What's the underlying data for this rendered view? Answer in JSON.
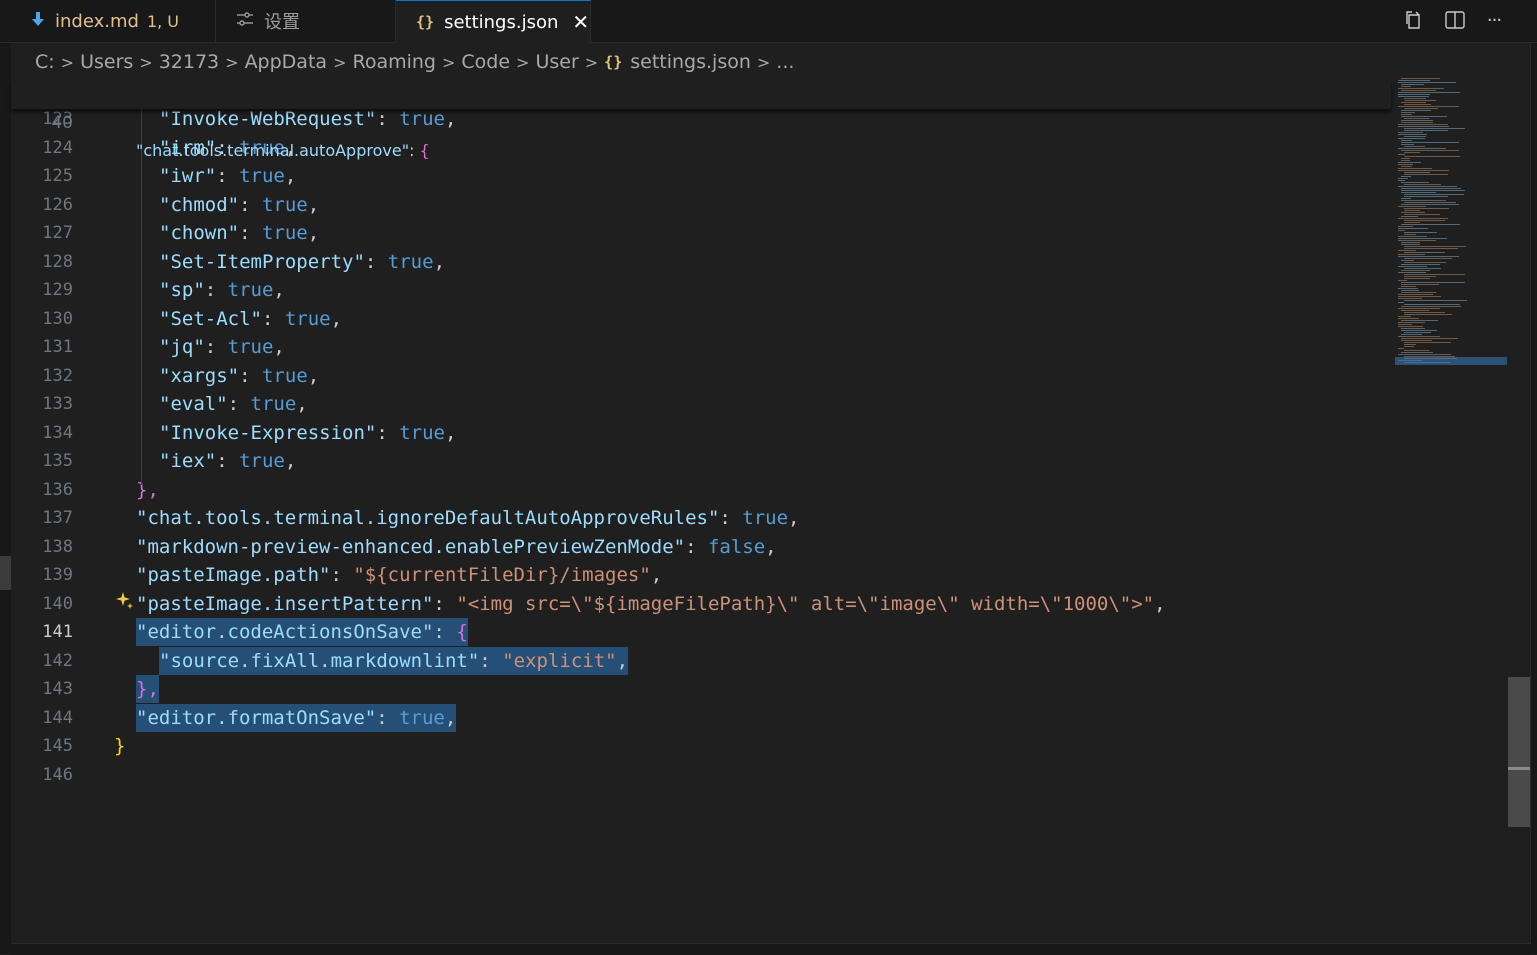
{
  "tabs": [
    {
      "icon": "markdown-icon",
      "name": "index.md",
      "badge": "1, U"
    },
    {
      "icon": "settings-sliders-icon",
      "name": "设置"
    },
    {
      "icon": "json-braces-icon",
      "name": "settings.json",
      "close": "✕"
    }
  ],
  "toolbar": {
    "open_changes": "open-changes-icon",
    "split_editor": "split-editor-icon",
    "more_actions": "···"
  },
  "breadcrumb": [
    "C:",
    "Users",
    "32173",
    "AppData",
    "Roaming",
    "Code",
    "User",
    "settings.json",
    "..."
  ],
  "sticky": {
    "num": "40",
    "key": "\"chat.tools.terminal.autoApprove\"",
    "colon": ": ",
    "brace": "{"
  },
  "lines": [
    {
      "num": "123",
      "key": "\"Invoke-WebRequest\"",
      "val": "true"
    },
    {
      "num": "124",
      "key": "\"irm\"",
      "val": "true"
    },
    {
      "num": "125",
      "key": "\"iwr\"",
      "val": "true"
    },
    {
      "num": "126",
      "key": "\"chmod\"",
      "val": "true"
    },
    {
      "num": "127",
      "key": "\"chown\"",
      "val": "true"
    },
    {
      "num": "128",
      "key": "\"Set-ItemProperty\"",
      "val": "true"
    },
    {
      "num": "129",
      "key": "\"sp\"",
      "val": "true"
    },
    {
      "num": "130",
      "key": "\"Set-Acl\"",
      "val": "true"
    },
    {
      "num": "131",
      "key": "\"jq\"",
      "val": "true"
    },
    {
      "num": "132",
      "key": "\"xargs\"",
      "val": "true"
    },
    {
      "num": "133",
      "key": "\"eval\"",
      "val": "true"
    },
    {
      "num": "134",
      "key": "\"Invoke-Expression\"",
      "val": "true"
    },
    {
      "num": "135",
      "key": "\"iex\"",
      "val": "true"
    },
    {
      "num": "136",
      "close": "},"
    },
    {
      "num": "137",
      "key": "\"chat.tools.terminal.ignoreDefaultAutoApproveRules\"",
      "val": "true"
    },
    {
      "num": "138",
      "key": "\"markdown-preview-enhanced.enablePreviewZenMode\"",
      "val": "false"
    },
    {
      "num": "139",
      "key": "\"pasteImage.path\"",
      "str": "\"${currentFileDir}/images\""
    },
    {
      "num": "140",
      "key": "\"pasteImage.insertPattern\"",
      "str": "\"<img src=\\\"${imageFilePath}\\\" alt=\\\"image\\\" width=\\\"1000\\\">\""
    },
    {
      "num": "141",
      "key": "\"editor.codeActionsOnSave\"",
      "open": "{"
    },
    {
      "num": "142",
      "key": "\"source.fixAll.markdownlint\"",
      "str": "\"explicit\""
    },
    {
      "num": "143",
      "close": "},"
    },
    {
      "num": "144",
      "key": "\"editor.formatOnSave\"",
      "val": "true"
    },
    {
      "num": "145",
      "root_close": "}"
    },
    {
      "num": "146"
    }
  ]
}
